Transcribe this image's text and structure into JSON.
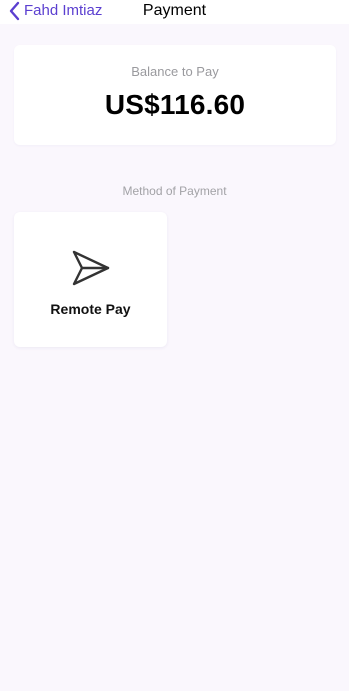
{
  "nav": {
    "back_label": "Fahd Imtiaz",
    "title": "Payment",
    "back_icon": "chevron-left-icon"
  },
  "balance": {
    "label": "Balance to Pay",
    "amount": "US$116.60"
  },
  "payment_methods": {
    "section_label": "Method of Payment",
    "items": [
      {
        "label": "Remote Pay",
        "icon": "send-icon"
      }
    ]
  },
  "colors": {
    "accent": "#5B3FD0",
    "background": "#FAF7FD",
    "card": "#FFFFFF",
    "muted_text": "#9A9A9E"
  }
}
